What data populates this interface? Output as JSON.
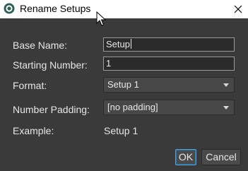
{
  "window": {
    "title": "Rename Setups",
    "app_icon": "app-logo-icon",
    "close_icon": "close-icon"
  },
  "form": {
    "base_name_label": "Base Name:",
    "base_name_value": "Setup",
    "starting_number_label": "Starting Number:",
    "starting_number_value": "1",
    "format_label": "Format:",
    "format_selected": "Setup 1",
    "number_padding_label": "Number Padding:",
    "number_padding_selected": "[no padding]",
    "example_label": "Example:",
    "example_value": "Setup 1"
  },
  "buttons": {
    "ok_label": "OK",
    "cancel_label": "Cancel"
  },
  "colors": {
    "background": "#3a3a3a",
    "titlebar": "#ffffff",
    "text": "#e6e6e6",
    "focus_accent": "#4aa3e0"
  }
}
